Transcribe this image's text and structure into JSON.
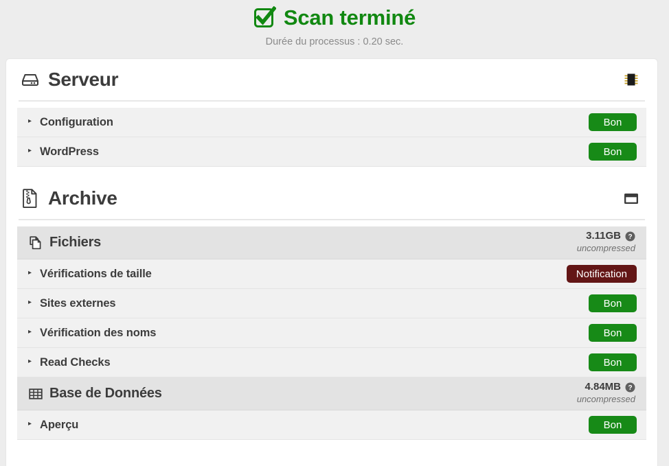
{
  "header": {
    "icon": "check-square-icon",
    "title": "Scan terminé",
    "subtitle": "Durée du processus : 0.20 sec.",
    "title_color": "#118811"
  },
  "colors": {
    "good_badge": "#178a17",
    "notice_badge": "#631616",
    "page_background": "#ededed",
    "card_background": "#ffffff",
    "row_background": "#f1f1f1",
    "group_row_background": "#e3e3e3",
    "text": "#3c3c3c"
  },
  "sections": [
    {
      "title": "Serveur",
      "icon": "hard-drive-icon",
      "right_icon": "microchip-icon",
      "rows": [
        {
          "label": "Configuration",
          "type": "item",
          "status": "Bon",
          "status_kind": "good"
        },
        {
          "label": "WordPress",
          "type": "item",
          "status": "Bon",
          "status_kind": "good"
        }
      ]
    },
    {
      "title": "Archive",
      "icon": "file-archive-icon",
      "right_icon": "window-icon",
      "rows": [
        {
          "label": "Fichiers",
          "type": "group",
          "icon": "files-copy-icon",
          "size_value": "3.11GB",
          "size_note": "uncompressed",
          "help_icon": "help-circle-icon"
        },
        {
          "label": "Vérifications de taille",
          "type": "item",
          "status": "Notification",
          "status_kind": "notice"
        },
        {
          "label": "Sites externes",
          "type": "item",
          "status": "Bon",
          "status_kind": "good"
        },
        {
          "label": "Vérification des noms",
          "type": "item",
          "status": "Bon",
          "status_kind": "good"
        },
        {
          "label": "Read Checks",
          "type": "item",
          "status": "Bon",
          "status_kind": "good"
        },
        {
          "label": "Base de Données",
          "type": "group",
          "icon": "table-grid-icon",
          "size_value": "4.84MB",
          "size_note": "uncompressed",
          "help_icon": "help-circle-icon"
        },
        {
          "label": "Aperçu",
          "type": "item",
          "status": "Bon",
          "status_kind": "good"
        }
      ]
    }
  ]
}
